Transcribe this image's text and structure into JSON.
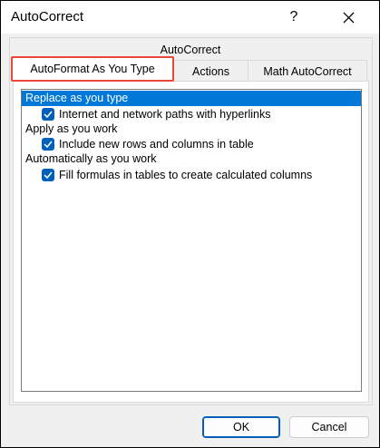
{
  "window": {
    "title": "AutoCorrect",
    "help_label": "?"
  },
  "tabs": {
    "row1": [
      {
        "label": "AutoCorrect",
        "selected": false
      }
    ],
    "row2": [
      {
        "label": "AutoFormat As You Type",
        "selected": true
      },
      {
        "label": "Actions",
        "selected": false
      },
      {
        "label": "Math AutoCorrect",
        "selected": false
      }
    ]
  },
  "list": {
    "groups": [
      {
        "header": "Replace as you type",
        "highlighted": true,
        "options": [
          {
            "label": "Internet and network paths with hyperlinks",
            "checked": true
          }
        ]
      },
      {
        "header": "Apply as you work",
        "highlighted": false,
        "options": [
          {
            "label": "Include new rows and columns in table",
            "checked": true
          }
        ]
      },
      {
        "header": "Automatically as you work",
        "highlighted": false,
        "options": [
          {
            "label": "Fill formulas in tables to create calculated columns",
            "checked": true
          }
        ]
      }
    ]
  },
  "buttons": {
    "ok": "OK",
    "cancel": "Cancel"
  },
  "colors": {
    "selection": "#0078d7",
    "checkbox": "#005fb8",
    "tab_highlight_border": "#e8473a"
  }
}
